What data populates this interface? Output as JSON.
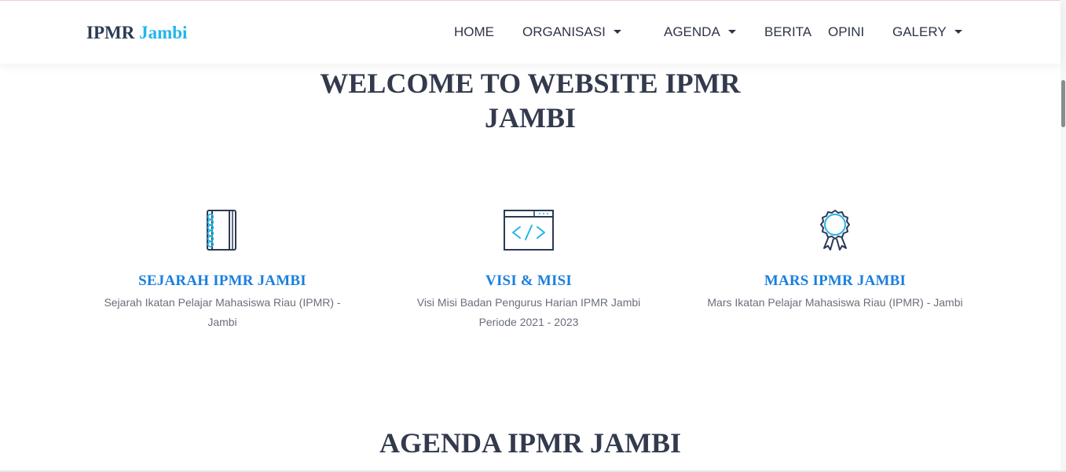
{
  "brand": {
    "name": "IPMR",
    "accent": "Jambi"
  },
  "nav": {
    "home": "HOME",
    "organisasi": "ORGANISASI",
    "agenda": "AGENDA",
    "berita": "BERITA",
    "opini": "OPINI",
    "galery": "GALERY"
  },
  "hero": {
    "line1": "WELCOME TO WEBSITE IPMR",
    "line2": "JAMBI"
  },
  "features": [
    {
      "title": "SEJARAH IPMR JAMBI",
      "desc": "Sejarah Ikatan Pelajar Mahasiswa Riau (IPMR) - Jambi",
      "icon": "notebook-icon"
    },
    {
      "title": "VISI & MISI",
      "desc": "Visi Misi Badan Pengurus Harian IPMR Jambi Periode 2021 - 2023",
      "icon": "code-window-icon"
    },
    {
      "title": "MARS IPMR JAMBI",
      "desc": "Mars Ikatan Pelajar Mahasiswa Riau (IPMR) - Jambi",
      "icon": "award-badge-icon"
    }
  ],
  "agenda_section": {
    "title": "AGENDA IPMR JAMBI"
  },
  "colors": {
    "accent": "#23b5e8",
    "link_blue": "#1a7fde",
    "dark_text": "#333a4d"
  }
}
